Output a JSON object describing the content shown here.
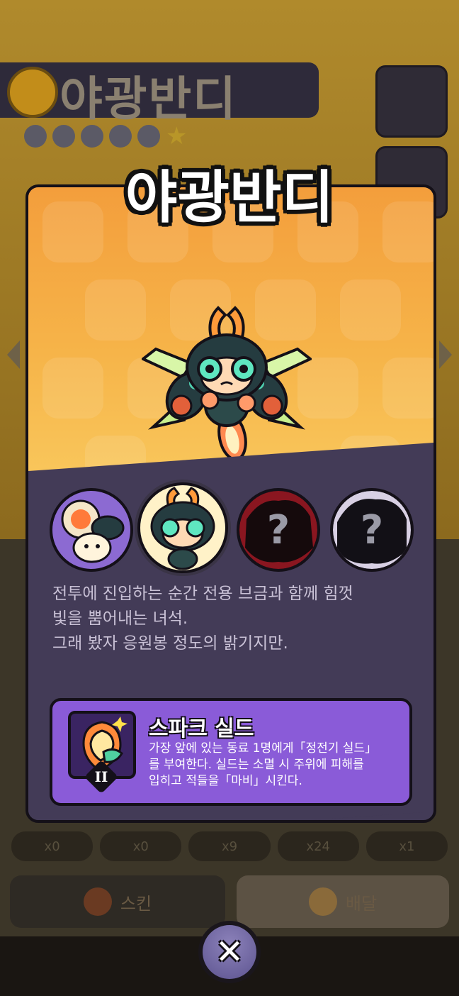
{
  "background": {
    "name": "야광반디",
    "stats": [
      "x0",
      "x0",
      "x9",
      "x24",
      "x1"
    ],
    "buttons": [
      "스킨",
      "배달"
    ]
  },
  "modal": {
    "title": "야광반디",
    "skins": [
      {
        "label": "skin-1",
        "locked": false
      },
      {
        "label": "skin-2",
        "locked": false,
        "selected": true
      },
      {
        "label": "?",
        "locked": true
      },
      {
        "label": "?",
        "locked": true
      }
    ],
    "description": [
      "전투에 진입하는 순간 전용 브금과 함께 힘껏",
      "빛을 뿜어내는 녀석.",
      "그래 봤자 응원봉 정도의 밝기지만."
    ],
    "skill": {
      "name": "스파크 실드",
      "level": "II",
      "description": [
        "가장 앞에 있는 동료 1명에게「정전기 실드」",
        "를 부여한다. 실드는 소멸 시 주위에 피해를",
        "입히고 적들을「마비」시킨다."
      ]
    },
    "close_icon": "close-x-icon"
  },
  "colors": {
    "art_top": "#f39e3c",
    "art_bottom": "#fbd267",
    "panel": "#433b57",
    "skill_box": "#8a5bd8",
    "close_button": "#6f65a3"
  }
}
